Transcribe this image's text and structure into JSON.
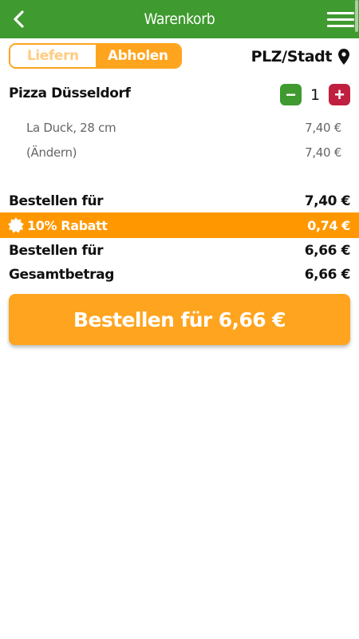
{
  "app_bar": {
    "title": "Warenkorb",
    "back_icon": "chevron-left-icon",
    "menu_icon": "hamburger-menu-icon",
    "color": "#3f9a2f"
  },
  "delivery_mode": {
    "options": [
      "Liefern",
      "Abholen"
    ],
    "selected": "Abholen",
    "accent_color": "#ffa41e"
  },
  "location": {
    "label": "PLZ/Stadt",
    "icon": "map-pin-icon"
  },
  "cart_item": {
    "name": "Pizza Düsseldorf",
    "quantity": "1",
    "minus_label": "−",
    "plus_label": "+",
    "details": [
      {
        "label": "La Duck, 28 cm",
        "price": "7,40 €"
      },
      {
        "label": "(Ändern)",
        "price": "7,40 €"
      }
    ]
  },
  "summary": {
    "subtotal_label": "Bestellen für",
    "subtotal_value": "7,40 €",
    "discount_label": "10% Rabatt",
    "discount_value": "0,74 €",
    "discount_icon": "badge-icon",
    "discount_color": "#ff9800",
    "after_discount_label": "Bestellen für",
    "after_discount_value": "6,66 €",
    "total_label": "Gesamtbetrag",
    "total_value": "6,66 €"
  },
  "order_button": {
    "label": "Bestellen für 6,66 €"
  }
}
